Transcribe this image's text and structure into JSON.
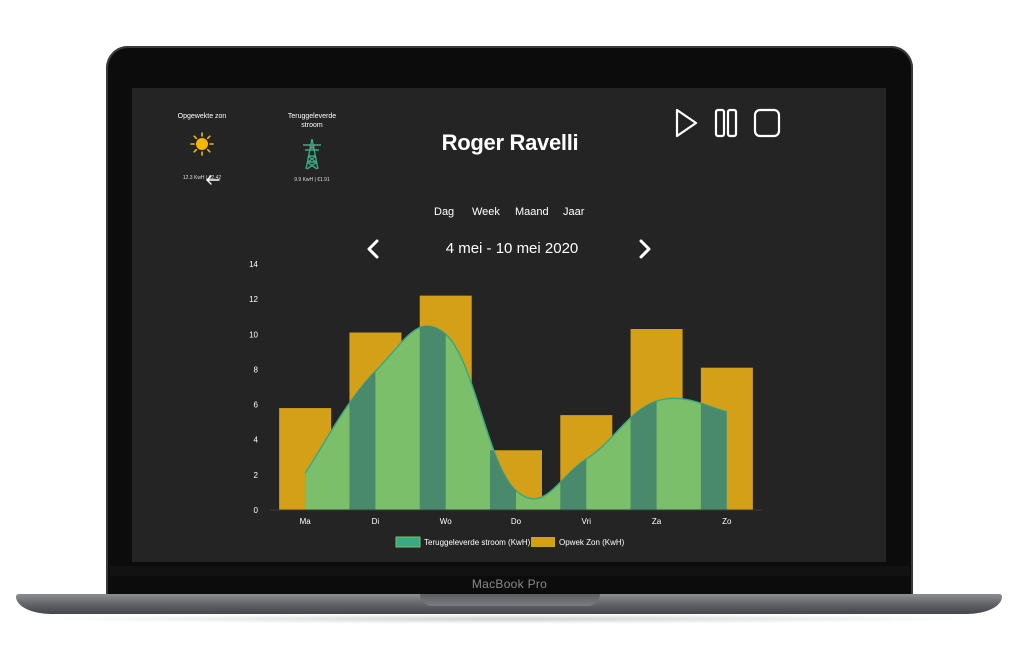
{
  "device": {
    "brand": "MacBook Pro"
  },
  "widgets": {
    "sun": {
      "title": "Opgewekte zon",
      "stats": "12.3 KwH | €2.42"
    },
    "grid": {
      "title": "Teruggeleverde stroom",
      "stats": "9.9 KwH | €1.91"
    }
  },
  "header": {
    "title": "Roger Ravelli"
  },
  "controls": {
    "play_icon": "play-icon",
    "pause_icon": "pause-icon",
    "stop_icon": "stop-icon"
  },
  "period_tabs": [
    "Dag",
    "Week",
    "Maand",
    "Jaar"
  ],
  "range": {
    "label": "4 mei - 10 mei 2020",
    "prev_icon": "chevron-left-icon",
    "next_icon": "chevron-right-icon"
  },
  "colors": {
    "screen_bg": "#242424",
    "bar": "#d4a017",
    "area_fill": "#7bbf6a",
    "area_line": "#3aa983",
    "overlap": "#4a8a6c",
    "sun_icon": "#f5b700",
    "pylon_icon": "#3aa983"
  },
  "chart_data": {
    "type": "bar",
    "categories": [
      "Ma",
      "Di",
      "Wo",
      "Do",
      "Vri",
      "Za",
      "Zo"
    ],
    "series": [
      {
        "name": "Teruggeleverde stroom (KwH)",
        "type": "area",
        "values": [
          2.1,
          7.9,
          10.0,
          1.1,
          2.9,
          6.2,
          5.6
        ]
      },
      {
        "name": "Opwek Zon (KwH)",
        "type": "bar",
        "values": [
          5.8,
          10.1,
          12.2,
          3.4,
          5.4,
          10.3,
          8.1
        ]
      }
    ],
    "y_ticks": [
      0,
      2,
      4,
      6,
      8,
      10,
      12,
      14
    ],
    "ylim": [
      0,
      14
    ],
    "grid": false,
    "legend": "bottom"
  }
}
